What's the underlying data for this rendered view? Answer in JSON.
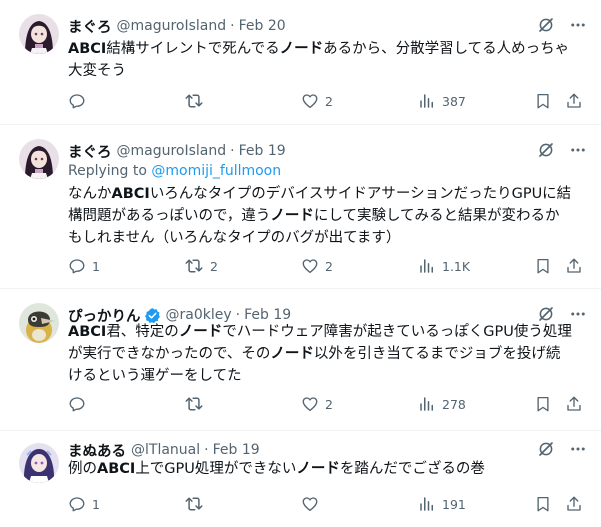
{
  "tweets": [
    {
      "name": "まぐろ",
      "handle": "@maguroIsland",
      "date": "Feb 20",
      "replying_to_prefix": "",
      "replying_to_handle": "",
      "text_segments": [
        {
          "t": "ABCI",
          "b": true
        },
        {
          "t": "結構サイレントで死んでる",
          "b": false
        },
        {
          "t": "ノード",
          "b": true
        },
        {
          "t": "あるから、分散学習してる人めっちゃ",
          "b": false
        },
        {
          "t": "\n",
          "b": false
        },
        {
          "t": "大変そう",
          "b": false
        }
      ],
      "stats": {
        "reply": "",
        "retweet": "",
        "like": "2",
        "views": "387"
      }
    },
    {
      "name": "まぐろ",
      "handle": "@maguroIsland",
      "date": "Feb 19",
      "replying_to_prefix": "Replying to ",
      "replying_to_handle": "@momiji_fullmoon",
      "text_segments": [
        {
          "t": "なんか",
          "b": false
        },
        {
          "t": "ABCI",
          "b": true
        },
        {
          "t": "いろんなタイプのデバイスサイドアサーションだったりGPUに結",
          "b": false
        },
        {
          "t": "\n",
          "b": false
        },
        {
          "t": "構問題があるっぽいので，違う",
          "b": false
        },
        {
          "t": "ノード",
          "b": true
        },
        {
          "t": "にして実験してみると結果が変わるか",
          "b": false
        },
        {
          "t": "\n",
          "b": false
        },
        {
          "t": "もしれません（いろんなタイプのバグが出てます）",
          "b": false
        }
      ],
      "stats": {
        "reply": "1",
        "retweet": "2",
        "like": "2",
        "views": "1.1K"
      }
    },
    {
      "name": "ぴっかりん",
      "handle": "@ra0kley",
      "date": "Feb 19",
      "verified": true,
      "replying_to_prefix": "",
      "replying_to_handle": "",
      "text_segments": [
        {
          "t": "ABCI",
          "b": true
        },
        {
          "t": "君、特定の",
          "b": false
        },
        {
          "t": "ノード",
          "b": true
        },
        {
          "t": "でハードウェア障害が起きているっぽくGPU使う処理",
          "b": false
        },
        {
          "t": "\n",
          "b": false
        },
        {
          "t": "が実行できなかったので、その",
          "b": false
        },
        {
          "t": "ノード",
          "b": true
        },
        {
          "t": "以外を引き当てるまでジョブを投げ続",
          "b": false
        },
        {
          "t": "\n",
          "b": false
        },
        {
          "t": "けるという運ゲーをしてた",
          "b": false
        }
      ],
      "stats": {
        "reply": "",
        "retweet": "",
        "like": "2",
        "views": "278"
      }
    },
    {
      "name": "まぬある",
      "handle": "@lTlanual",
      "date": "Feb 19",
      "replying_to_prefix": "",
      "replying_to_handle": "",
      "text_segments": [
        {
          "t": "例の",
          "b": false
        },
        {
          "t": "ABCI",
          "b": true
        },
        {
          "t": "上でGPU処理ができない",
          "b": false
        },
        {
          "t": "ノード",
          "b": true
        },
        {
          "t": "を踏んだでござるの巻",
          "b": false
        }
      ],
      "stats": {
        "reply": "1",
        "retweet": "",
        "like": "",
        "views": "191"
      }
    }
  ],
  "icons": {
    "grok": "grok-icon",
    "more": "more-icon",
    "reply": "reply-icon",
    "retweet": "retweet-icon",
    "like": "like-icon",
    "views": "views-icon",
    "bookmark": "bookmark-icon",
    "share": "share-icon",
    "verified": "verified-badge-icon"
  },
  "colors": {
    "text": "#0f1419",
    "secondary": "#536471",
    "link": "#1d9bf0",
    "verified": "#1d9bf0",
    "divider": "#eff3f4"
  }
}
